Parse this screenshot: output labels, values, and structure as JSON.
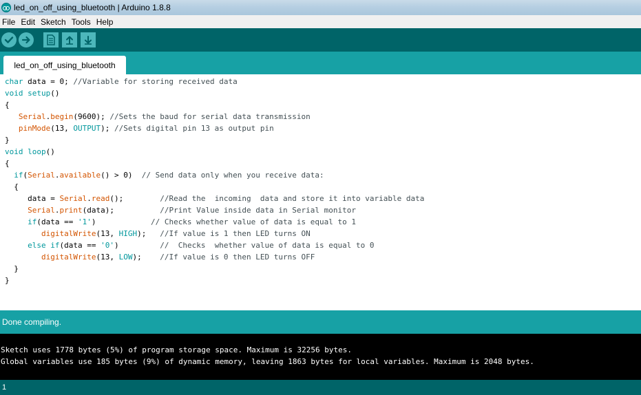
{
  "window": {
    "title": "led_on_off_using_bluetooth | Arduino 1.8.8"
  },
  "menu": [
    "File",
    "Edit",
    "Sketch",
    "Tools",
    "Help"
  ],
  "toolbar": {
    "buttons": [
      "verify-icon",
      "upload-icon",
      "new-icon",
      "open-icon",
      "save-icon"
    ]
  },
  "tabs": [
    {
      "label": "led_on_off_using_bluetooth"
    }
  ],
  "code_lines": [
    [
      [
        "kw",
        "char"
      ],
      [
        "t",
        " data = 0; "
      ],
      [
        "cm",
        "//Variable for storing received data"
      ]
    ],
    [
      [
        "kw",
        "void"
      ],
      [
        "t",
        " "
      ],
      [
        "kw",
        "setup"
      ],
      [
        "t",
        "()"
      ]
    ],
    [
      [
        "t",
        "{"
      ]
    ],
    [
      [
        "t",
        "   "
      ],
      [
        "fn",
        "Serial"
      ],
      [
        "t",
        "."
      ],
      [
        "fn",
        "begin"
      ],
      [
        "t",
        "(9600); "
      ],
      [
        "cm",
        "//Sets the baud for serial data transmission"
      ]
    ],
    [
      [
        "t",
        "   "
      ],
      [
        "fn",
        "pinMode"
      ],
      [
        "t",
        "(13, "
      ],
      [
        "cn",
        "OUTPUT"
      ],
      [
        "t",
        "); "
      ],
      [
        "cm",
        "//Sets digital pin 13 as output pin"
      ]
    ],
    [
      [
        "t",
        "}"
      ]
    ],
    [
      [
        "kw",
        "void"
      ],
      [
        "t",
        " "
      ],
      [
        "kw",
        "loop"
      ],
      [
        "t",
        "()"
      ]
    ],
    [
      [
        "t",
        "{"
      ]
    ],
    [
      [
        "t",
        "  "
      ],
      [
        "kw",
        "if"
      ],
      [
        "t",
        "("
      ],
      [
        "fn",
        "Serial"
      ],
      [
        "t",
        "."
      ],
      [
        "fn",
        "available"
      ],
      [
        "t",
        "() > 0)  "
      ],
      [
        "cm",
        "// Send data only when you receive data:"
      ]
    ],
    [
      [
        "t",
        "  {"
      ]
    ],
    [
      [
        "t",
        "     data = "
      ],
      [
        "fn",
        "Serial"
      ],
      [
        "t",
        "."
      ],
      [
        "fn",
        "read"
      ],
      [
        "t",
        "();        "
      ],
      [
        "cm",
        "//Read the  incoming  data and store it into variable data"
      ]
    ],
    [
      [
        "t",
        "     "
      ],
      [
        "fn",
        "Serial"
      ],
      [
        "t",
        "."
      ],
      [
        "fn",
        "print"
      ],
      [
        "t",
        "(data);          "
      ],
      [
        "cm",
        "//Print Value inside data in Serial monitor"
      ]
    ],
    [
      [
        "t",
        "     "
      ],
      [
        "kw",
        "if"
      ],
      [
        "t",
        "(data == "
      ],
      [
        "cn",
        "'1'"
      ],
      [
        "t",
        ")            "
      ],
      [
        "cm",
        "// Checks whether value of data is equal to 1"
      ]
    ],
    [
      [
        "t",
        "        "
      ],
      [
        "fn",
        "digitalWrite"
      ],
      [
        "t",
        "(13, "
      ],
      [
        "cn",
        "HIGH"
      ],
      [
        "t",
        ");   "
      ],
      [
        "cm",
        "//If value is 1 then LED turns ON"
      ]
    ],
    [
      [
        "t",
        "     "
      ],
      [
        "kw",
        "else"
      ],
      [
        "t",
        " "
      ],
      [
        "kw",
        "if"
      ],
      [
        "t",
        "(data == "
      ],
      [
        "cn",
        "'0'"
      ],
      [
        "t",
        ")         "
      ],
      [
        "cm",
        "//  Checks  whether value of data is equal to 0"
      ]
    ],
    [
      [
        "t",
        "        "
      ],
      [
        "fn",
        "digitalWrite"
      ],
      [
        "t",
        "(13, "
      ],
      [
        "cn",
        "LOW"
      ],
      [
        "t",
        ");    "
      ],
      [
        "cm",
        "//If value is 0 then LED turns OFF"
      ]
    ],
    [
      [
        "t",
        "  }"
      ]
    ],
    [
      [
        "t",
        "}"
      ]
    ]
  ],
  "status": {
    "message": "Done compiling."
  },
  "console": {
    "lines": [
      "Sketch uses 1778 bytes (5%) of program storage space. Maximum is 32256 bytes.",
      "Global variables use 185 bytes (9%) of dynamic memory, leaving 1863 bytes for local variables. Maximum is 2048 bytes."
    ]
  },
  "footer": {
    "line_number": "1"
  },
  "colors": {
    "toolbar": "#006468",
    "tab_strip": "#17a1a5",
    "keyword": "#00979c",
    "function": "#d35400",
    "comment": "#434f54"
  }
}
